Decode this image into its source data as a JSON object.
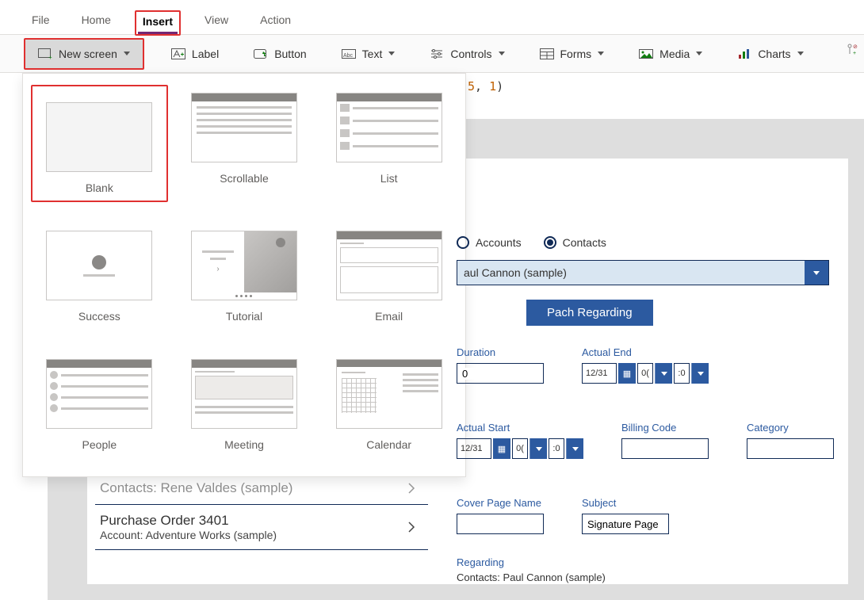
{
  "menubar": {
    "items": [
      "File",
      "Home",
      "Insert",
      "View",
      "Action"
    ],
    "activeIndex": 2
  },
  "ribbon": {
    "newscreen": "New screen",
    "label": "Label",
    "button": "Button",
    "text": "Text",
    "controls": "Controls",
    "forms": "Forms",
    "media": "Media",
    "charts": "Charts"
  },
  "formula_snippet": {
    "a": "5",
    "comma": ", ",
    "b": "1",
    "close": ")"
  },
  "gallery": {
    "items": [
      "Blank",
      "Scrollable",
      "List",
      "Success",
      "Tutorial",
      "Email",
      "People",
      "Meeting",
      "Calendar"
    ],
    "selectedIndex": 0
  },
  "list": [
    {
      "title": "Contacts: Rene Valdes (sample)",
      "sub": ""
    },
    {
      "title": "Purchase Order 3401",
      "sub": "Account: Adventure Works (sample)"
    }
  ],
  "form": {
    "radios": {
      "accounts": "Accounts",
      "contacts": "Contacts"
    },
    "combo_value": "aul Cannon (sample)",
    "primary_button": "Pach Regarding",
    "fields": {
      "duration": {
        "label": "Duration",
        "value": "0"
      },
      "actual_end": {
        "label": "Actual End",
        "date": "12/31"
      },
      "actual_start": {
        "label": "Actual Start",
        "date": "12/31"
      },
      "billing_code": {
        "label": "Billing Code",
        "value": ""
      },
      "category": {
        "label": "Category",
        "value": ""
      },
      "cover_page": {
        "label": "Cover Page Name",
        "value": ""
      },
      "subject": {
        "label": "Subject",
        "value": "Signature Page"
      }
    },
    "regarding": {
      "label": "Regarding",
      "value": "Contacts: Paul Cannon (sample)"
    }
  }
}
